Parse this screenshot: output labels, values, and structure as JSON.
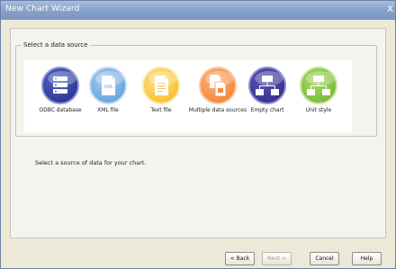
{
  "window": {
    "title": "New Chart Wizard",
    "close_glyph": "X"
  },
  "group": {
    "legend": "Select a data source"
  },
  "sources": [
    {
      "label": "ODBC database",
      "icon": "database-icon"
    },
    {
      "label": "XML file",
      "icon": "xml-file-icon"
    },
    {
      "label": "Text file",
      "icon": "text-file-icon"
    },
    {
      "label": "Multiple data sources",
      "icon": "multiple-sources-icon"
    },
    {
      "label": "Empty chart",
      "icon": "org-chart-icon"
    },
    {
      "label": "Unit style",
      "icon": "org-chart-icon"
    }
  ],
  "hint": "Select a source of data for your chart.",
  "buttons": {
    "back": "< Back",
    "next": "Next >",
    "cancel": "Cancel",
    "help": "Help"
  },
  "colors": {
    "odbc": "#303a98",
    "xml": "#6ea7df",
    "text": "#f8c43a",
    "multi": "#f48c42",
    "empty": "#3a338f",
    "unit": "#7fbe3c"
  }
}
